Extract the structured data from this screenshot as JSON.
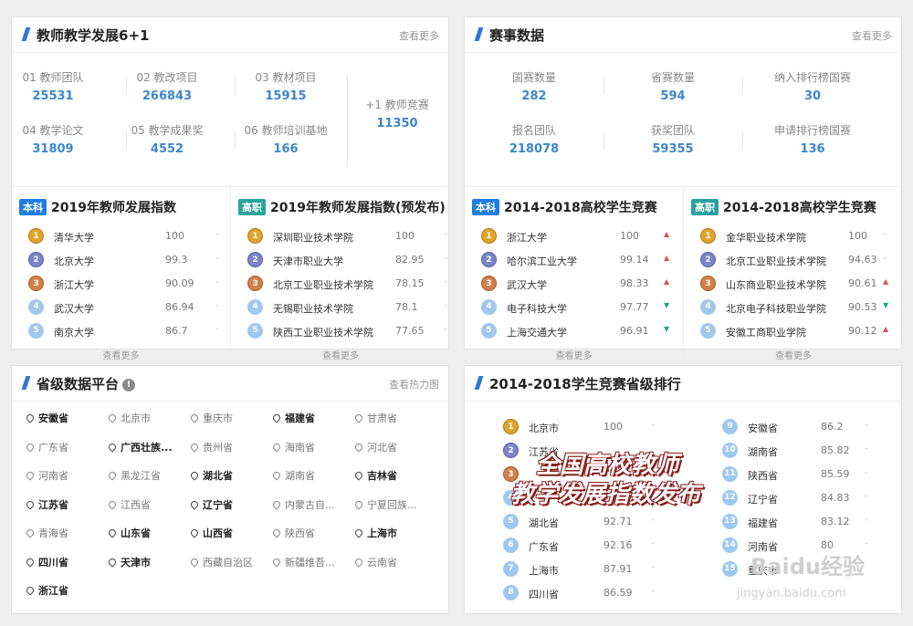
{
  "teacher": {
    "title": "教师教学发展6+1",
    "more": "查看更多",
    "stats": [
      {
        "label": "01 教师团队",
        "value": "25531"
      },
      {
        "label": "02 教改项目",
        "value": "266843"
      },
      {
        "label": "03 教材项目",
        "value": "15915"
      },
      {
        "label": "04 教学论文",
        "value": "31809"
      },
      {
        "label": "05 教学成果奖",
        "value": "4552"
      },
      {
        "label": "06 教师培训基地",
        "value": "166"
      }
    ],
    "plus": {
      "label": "+1 教师竞赛",
      "value": "11350"
    },
    "rank_left": {
      "tag": "本科",
      "title": "2019年教师发展指数",
      "more": "查看更多",
      "rows": [
        {
          "rank": "1",
          "name": "清华大学",
          "score": "100",
          "trend": "–"
        },
        {
          "rank": "2",
          "name": "北京大学",
          "score": "99.3",
          "trend": "–"
        },
        {
          "rank": "3",
          "name": "浙江大学",
          "score": "90.09",
          "trend": "–"
        },
        {
          "rank": "4",
          "name": "武汉大学",
          "score": "86.94",
          "trend": "–"
        },
        {
          "rank": "5",
          "name": "南京大学",
          "score": "86.7",
          "trend": "–"
        }
      ]
    },
    "rank_right": {
      "tag": "高职",
      "title": "2019年教师发展指数(预发布)",
      "more": "查看更多",
      "rows": [
        {
          "rank": "1",
          "name": "深圳职业技术学院",
          "score": "100",
          "trend": "–"
        },
        {
          "rank": "2",
          "name": "天津市职业大学",
          "score": "82.95",
          "trend": "–"
        },
        {
          "rank": "3",
          "name": "北京工业职业技术学院",
          "score": "78.15",
          "trend": "–"
        },
        {
          "rank": "4",
          "name": "无锡职业技术学院",
          "score": "78.1",
          "trend": "–"
        },
        {
          "rank": "5",
          "name": "陕西工业职业技术学院",
          "score": "77.65",
          "trend": "–"
        }
      ]
    }
  },
  "contest": {
    "title": "赛事数据",
    "more": "查看更多",
    "stats": [
      {
        "label": "国赛数量",
        "value": "282"
      },
      {
        "label": "省赛数量",
        "value": "594"
      },
      {
        "label": "纳入排行榜国赛",
        "value": "30"
      },
      {
        "label": "报名团队",
        "value": "218078"
      },
      {
        "label": "获奖团队",
        "value": "59355"
      },
      {
        "label": "申请排行榜国赛",
        "value": "136"
      }
    ],
    "rank_left": {
      "tag": "本科",
      "title": "2014-2018高校学生竞赛",
      "more": "查看更多",
      "rows": [
        {
          "rank": "1",
          "name": "浙江大学",
          "score": "100",
          "trend": "▲"
        },
        {
          "rank": "2",
          "name": "哈尔滨工业大学",
          "score": "99.14",
          "trend": "▲"
        },
        {
          "rank": "3",
          "name": "武汉大学",
          "score": "98.33",
          "trend": "▲"
        },
        {
          "rank": "4",
          "name": "电子科技大学",
          "score": "97.77",
          "trend": "▼"
        },
        {
          "rank": "5",
          "name": "上海交通大学",
          "score": "96.91",
          "trend": "▼"
        }
      ]
    },
    "rank_right": {
      "tag": "高职",
      "title": "2014-2018高校学生竞赛",
      "more": "查看更多",
      "rows": [
        {
          "rank": "1",
          "name": "金华职业技术学院",
          "score": "100",
          "trend": "–"
        },
        {
          "rank": "2",
          "name": "北京工业职业技术学院",
          "score": "94.63",
          "trend": "–"
        },
        {
          "rank": "3",
          "name": "山东商业职业技术学院",
          "score": "90.61",
          "trend": "▲"
        },
        {
          "rank": "4",
          "name": "北京电子科技职业学院",
          "score": "90.53",
          "trend": "▼"
        },
        {
          "rank": "5",
          "name": "安徽工商职业学院",
          "score": "90.12",
          "trend": "▲"
        }
      ]
    }
  },
  "province_platform": {
    "title": "省级数据平台",
    "info": "!",
    "more": "查看热力图",
    "items": [
      {
        "name": "安徽省",
        "bold": true
      },
      {
        "name": "北京市",
        "bold": false
      },
      {
        "name": "重庆市",
        "bold": false
      },
      {
        "name": "福建省",
        "bold": true
      },
      {
        "name": "甘肃省",
        "bold": false
      },
      {
        "name": "广东省",
        "bold": false
      },
      {
        "name": "广西壮族...",
        "bold": true
      },
      {
        "name": "贵州省",
        "bold": false
      },
      {
        "name": "海南省",
        "bold": false
      },
      {
        "name": "河北省",
        "bold": false
      },
      {
        "name": "河南省",
        "bold": false
      },
      {
        "name": "黑龙江省",
        "bold": false
      },
      {
        "name": "湖北省",
        "bold": true
      },
      {
        "name": "湖南省",
        "bold": false
      },
      {
        "name": "吉林省",
        "bold": true
      },
      {
        "name": "江苏省",
        "bold": true
      },
      {
        "name": "江西省",
        "bold": false
      },
      {
        "name": "辽宁省",
        "bold": true
      },
      {
        "name": "内蒙古自...",
        "bold": false
      },
      {
        "name": "宁夏回族...",
        "bold": false
      },
      {
        "name": "青海省",
        "bold": false
      },
      {
        "name": "山东省",
        "bold": true
      },
      {
        "name": "山西省",
        "bold": true
      },
      {
        "name": "陕西省",
        "bold": false
      },
      {
        "name": "上海市",
        "bold": true
      },
      {
        "name": "四川省",
        "bold": true
      },
      {
        "name": "天津市",
        "bold": true
      },
      {
        "name": "西藏自治区",
        "bold": false
      },
      {
        "name": "新疆维吾...",
        "bold": false
      },
      {
        "name": "云南省",
        "bold": false
      },
      {
        "name": "浙江省",
        "bold": true
      }
    ]
  },
  "province_rank": {
    "title": "2014-2018学生竞赛省级排行",
    "left": [
      {
        "rank": "1",
        "name": "北京市",
        "score": "100",
        "trend": "–"
      },
      {
        "rank": "2",
        "name": "江苏省",
        "score": "",
        "trend": ""
      },
      {
        "rank": "3",
        "name": "",
        "score": "",
        "trend": ""
      },
      {
        "rank": "4",
        "name": "",
        "score": "",
        "trend": ""
      },
      {
        "rank": "5",
        "name": "湖北省",
        "score": "92.71",
        "trend": "–"
      },
      {
        "rank": "6",
        "name": "广东省",
        "score": "92.16",
        "trend": "–"
      },
      {
        "rank": "7",
        "name": "上海市",
        "score": "87.91",
        "trend": "–"
      },
      {
        "rank": "8",
        "name": "四川省",
        "score": "86.59",
        "trend": "–"
      }
    ],
    "right": [
      {
        "rank": "9",
        "name": "安徽省",
        "score": "86.2",
        "trend": "–"
      },
      {
        "rank": "10",
        "name": "湖南省",
        "score": "85.82",
        "trend": "–"
      },
      {
        "rank": "11",
        "name": "陕西省",
        "score": "85.59",
        "trend": "–"
      },
      {
        "rank": "12",
        "name": "辽宁省",
        "score": "84.83",
        "trend": "–"
      },
      {
        "rank": "13",
        "name": "福建省",
        "score": "83.12",
        "trend": "–"
      },
      {
        "rank": "14",
        "name": "河南省",
        "score": "80",
        "trend": "–"
      },
      {
        "rank": "15",
        "name": "重庆市",
        "score": "",
        "trend": ""
      }
    ],
    "overlay_line1": "全国高校教师",
    "overlay_line2": "教学发展指数发布"
  },
  "watermark": {
    "logo": "Baidu经验",
    "url": "jingyan.baidu.com"
  },
  "colors": {
    "accent": "#2e78d6",
    "value": "#3c86cd",
    "up": "#d9534f",
    "down": "#1aa68c",
    "tag_blue": "#1f7ee0",
    "tag_green": "#27a39b"
  }
}
